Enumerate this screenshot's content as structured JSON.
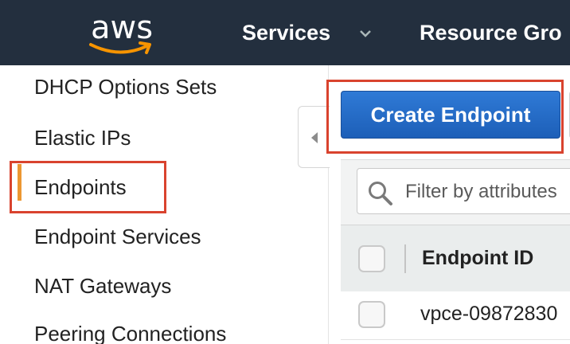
{
  "header": {
    "logo_text": "aws",
    "services_label": "Services",
    "resource_groups_label": "Resource Gro"
  },
  "sidebar": {
    "items": [
      {
        "label": "DHCP Options Sets"
      },
      {
        "label": "Elastic IPs"
      },
      {
        "label": "Endpoints",
        "active": true
      },
      {
        "label": "Endpoint Services"
      },
      {
        "label": "NAT Gateways"
      },
      {
        "label": "Peering Connections"
      }
    ]
  },
  "main": {
    "create_button_label": "Create Endpoint",
    "filter_placeholder": "Filter by attributes",
    "table": {
      "columns": [
        "Endpoint ID"
      ],
      "rows": [
        {
          "endpoint_id": "vpce-09872830"
        }
      ]
    }
  },
  "colors": {
    "topbar": "#232f3e",
    "accent_orange": "#ec9732",
    "highlight_red": "#d9432e",
    "primary_button": "#2f7ad6"
  }
}
